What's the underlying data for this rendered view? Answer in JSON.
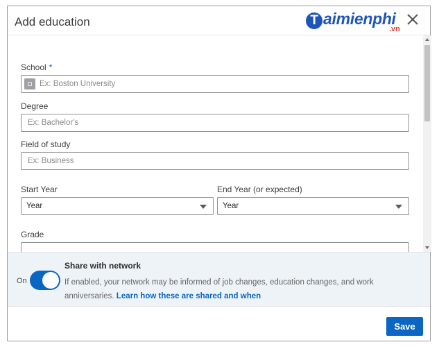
{
  "dialog": {
    "title": "Add education",
    "close_icon": "close-icon"
  },
  "watermark": {
    "brand_initial": "T",
    "brand_rest": "aimienphi",
    "suffix": ".vn"
  },
  "form": {
    "school": {
      "label": "School",
      "required_mark": "*",
      "placeholder": "Ex: Boston University",
      "icon": "school-icon"
    },
    "degree": {
      "label": "Degree",
      "placeholder": "Ex: Bachelor's"
    },
    "field_of_study": {
      "label": "Field of study",
      "placeholder": "Ex: Business"
    },
    "start_year": {
      "label": "Start Year",
      "value": "Year"
    },
    "end_year": {
      "label": "End Year (or expected)",
      "value": "Year"
    },
    "grade": {
      "label": "Grade"
    }
  },
  "share": {
    "title": "Share with network",
    "toggle_state": "On",
    "toggle_on": true,
    "description": "If enabled, your network may be informed of job changes, education changes, and work anniversaries.",
    "link_text": "Learn how these are shared and when"
  },
  "footer": {
    "save_label": "Save"
  },
  "colors": {
    "accent": "#0a66c2",
    "panel_bg": "#eef3f8"
  }
}
